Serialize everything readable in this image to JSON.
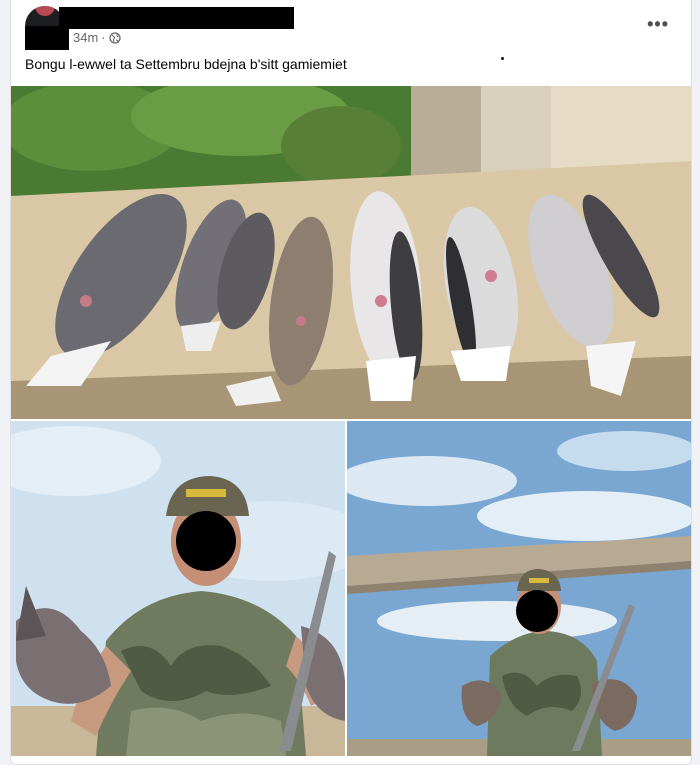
{
  "post": {
    "author_name": "",
    "timestamp": "34m",
    "separator": "·",
    "privacy_icon": "globe-icon",
    "more_options_label": "•••",
    "caption": "Bongu l-ewwel ta Settembru bdejna b'sitt gamiemiet"
  },
  "photos": [
    {
      "name": "photo-birds-on-ledge",
      "icon": "image"
    },
    {
      "name": "photo-man-holding-birds-left",
      "icon": "image"
    },
    {
      "name": "photo-man-holding-birds-right",
      "icon": "image"
    }
  ],
  "colors": {
    "background": "#f0f2f5",
    "card": "#ffffff",
    "text": "#050505",
    "secondary_text": "#65676b"
  }
}
